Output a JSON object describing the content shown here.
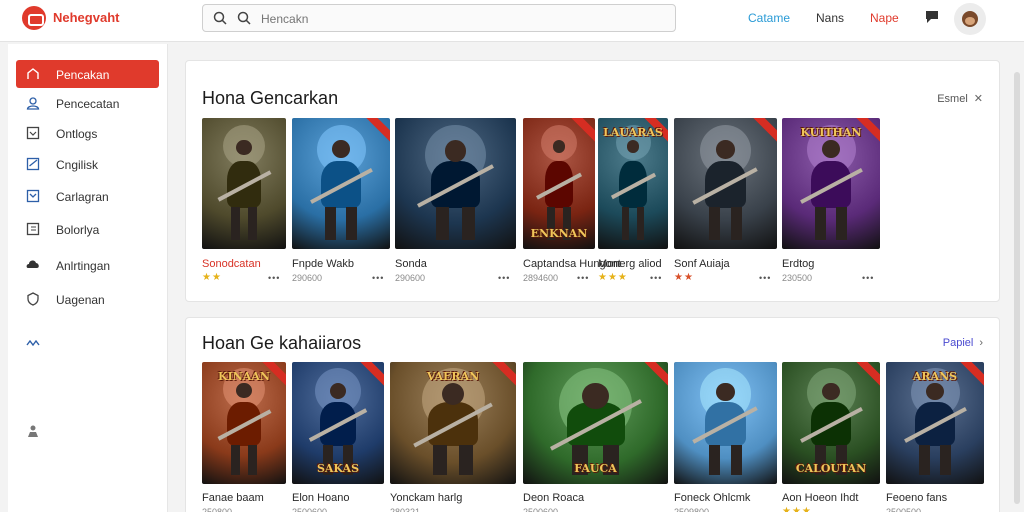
{
  "header": {
    "brand": "Nehegvaht",
    "search_placeholder": "Hencakn",
    "nav": [
      {
        "label": "Catame",
        "color": "#2a9bd6"
      },
      {
        "label": "Nans",
        "color": "#333333"
      },
      {
        "label": "Nape",
        "color": "#e03a2c"
      }
    ]
  },
  "sidebar": {
    "items": [
      {
        "label": "Pencakan",
        "icon": "home-icon",
        "active": true
      },
      {
        "label": "Pencecatan",
        "icon": "user-icon",
        "active": false
      },
      {
        "label": "Ontlogs",
        "icon": "box-icon",
        "active": false
      },
      {
        "label": "Cngilisk",
        "icon": "check-icon",
        "active": false
      },
      {
        "label": "Carlagran",
        "icon": "check-box-icon",
        "active": false
      },
      {
        "label": "Bolorlya",
        "icon": "grid-icon",
        "active": false
      },
      {
        "label": "Anlrtingan",
        "icon": "cloud-icon",
        "active": false
      },
      {
        "label": "Uagenan",
        "icon": "shield-icon",
        "active": false
      }
    ]
  },
  "sections": [
    {
      "title": "Hona Gencarkan",
      "link_label": "Esmel",
      "link_color": "#555555",
      "cards": [
        {
          "title": "Sonodcatan",
          "meta": "",
          "title_color": "#d83226",
          "stars": "★★",
          "dots": "•••",
          "art": "#4f4a2c",
          "label": ""
        },
        {
          "title": "Fnpde Wakb",
          "meta": "290600",
          "title_color": "#2a2a2a",
          "stars": "",
          "dots": "•••",
          "art": "#2a6fa5",
          "label": ""
        },
        {
          "title": "Sonda",
          "meta": "290600",
          "title_color": "#2a2a2a",
          "stars": "",
          "dots": "•••",
          "art": "#1d3650",
          "label": ""
        },
        {
          "title": "Captandsa Hungont",
          "meta": "2894600",
          "title_color": "#2a2a2a",
          "stars": "",
          "dots": "•••",
          "art": "#7a2412",
          "label": "ENKNAN"
        },
        {
          "title": "Monerg aliod",
          "meta": "",
          "title_color": "#2a2a2a",
          "stars": "★★★",
          "dots": "•••",
          "art": "#1c4a5a",
          "label": "LAUARAS"
        },
        {
          "title": "Sonf Auiaja",
          "meta": "",
          "title_color": "#2a2a2a",
          "stars": "★★",
          "dots": "•••",
          "art": "#39414a",
          "label": ""
        },
        {
          "title": "Erdtog",
          "meta": "230500",
          "title_color": "#2a2a2a",
          "stars": "",
          "dots": "•••",
          "art": "#5a2a78",
          "label": "KUITHAN"
        }
      ]
    },
    {
      "title": "Hoan Ge kahaiiaros",
      "link_label": "Papiel",
      "link_color": "#4a4ad0",
      "cards": [
        {
          "title": "Fanae baam",
          "meta": "250800",
          "title_color": "#2a2a2a",
          "stars": "",
          "dots": "",
          "art": "#8a3a1a",
          "label": "KINAAN"
        },
        {
          "title": "Elon Hoano",
          "meta": "2500600",
          "title_color": "#2a2a2a",
          "stars": "",
          "dots": "",
          "art": "#1f3c6a",
          "label": "SAKAS"
        },
        {
          "title": "Yonckam harlg",
          "meta": "280321",
          "title_color": "#2a2a2a",
          "stars": "",
          "dots": "",
          "art": "#6a4f2a",
          "label": "VAERAN"
        },
        {
          "title": "Deon Roaca",
          "meta": "2500600",
          "title_color": "#2a2a2a",
          "stars": "",
          "dots": "",
          "art": "#2f6a2a",
          "label": "FAUCA"
        },
        {
          "title": "Foneck Ohlcmk",
          "meta": "2509800",
          "title_color": "#2a2a2a",
          "stars": "",
          "dots": "",
          "art": "#4f8fc2",
          "label": ""
        },
        {
          "title": "Aon Hoeon Ihdt",
          "meta": "",
          "title_color": "#2a2a2a",
          "stars": "★★★",
          "dots": "",
          "art": "#2a4f22",
          "label": "CALOUTAN"
        },
        {
          "title": "Feoeno fans",
          "meta": "2500500",
          "title_color": "#2a2a2a",
          "stars": "",
          "dots": "",
          "art": "#2a3f5f",
          "label": "ARANS"
        }
      ]
    }
  ],
  "colors": {
    "accent": "#e03a2c",
    "link_blue": "#2a9bd6"
  }
}
